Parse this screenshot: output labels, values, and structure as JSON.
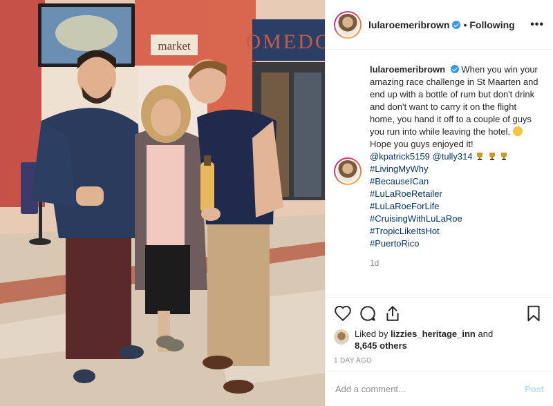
{
  "photo": {
    "sign_market": "market",
    "sign_store": "OMEDO"
  },
  "header": {
    "username": "lularoemeribrown",
    "separator": "•",
    "follow_status": "Following",
    "more_label": "•••"
  },
  "caption": {
    "author": "lularoemeribrown",
    "text_before_emoji": "When you win your amazing race challenge in St Maarten and end up with a bottle of rum but don't drink and don't want to carry it on the flight home, you hand it off to a couple of guys you run into while leaving the hotel.",
    "text_after_emoji": "Hope you guys enjoyed it!",
    "mentions": [
      "@kpatrick5159",
      "@tully314"
    ],
    "hashtags": [
      "#LivingMyWhy",
      "#BecauseICan",
      "#LuLaRoeRetailer",
      "#LuLaRoeForLife",
      "#CruisingWithLuLaRoe",
      "#TropicLikeItsHot",
      "#PuertoRico"
    ],
    "time_ago": "1d"
  },
  "actions": {
    "like_icon": "heart-icon",
    "comment_icon": "comment-icon",
    "share_icon": "share-icon",
    "save_icon": "bookmark-icon"
  },
  "likes": {
    "prefix": "Liked by",
    "liker": "lizzies_heritage_inn",
    "conjunction": "and",
    "count_text": "8,645 others"
  },
  "post_date": "1 DAY AGO",
  "add_comment": {
    "placeholder": "Add a comment...",
    "post_label": "Post"
  },
  "colors": {
    "link": "#003569",
    "verified": "#3897f0",
    "muted": "#8e8e8e",
    "post_disabled": "#b2dffc"
  }
}
